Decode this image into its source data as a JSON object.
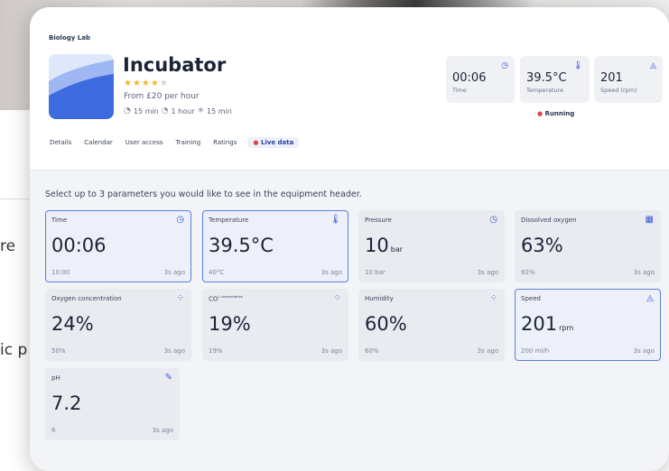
{
  "background": {
    "text_1": "re",
    "text_2": "ic p"
  },
  "breadcrumb": "Biology Lab",
  "equipment": {
    "name": "Incubator",
    "rating": 4,
    "rating_max": 5,
    "stars_filled": "★★★★",
    "stars_empty": "★",
    "price": "From £20 per hour",
    "durations": [
      "15 min",
      "1 hour",
      "15 min"
    ]
  },
  "tabs": [
    {
      "label": "Details"
    },
    {
      "label": "Calendar"
    },
    {
      "label": "User access"
    },
    {
      "label": "Training"
    },
    {
      "label": "Ratings"
    },
    {
      "label": "Live data",
      "active": true
    }
  ],
  "header_params": [
    {
      "value": "00:06",
      "label": "Time",
      "icon": "clock-icon"
    },
    {
      "value": "39.5°C",
      "label": "Temperature",
      "icon": "thermometer-icon"
    },
    {
      "value": "201",
      "label": "Speed (rpm)",
      "icon": "drop-icon"
    }
  ],
  "status": "Running",
  "instructions": "Select up to 3 parameters you would like to see in the equipment header.",
  "parameters": [
    {
      "name": "Time",
      "value": "00:06",
      "unit": "",
      "sub": "10:00",
      "ago": "3s ago",
      "icon": "clock-icon",
      "selected": true
    },
    {
      "name": "Temperature",
      "value": "39.5°C",
      "unit": "",
      "sub": "40°C",
      "ago": "3s ago",
      "icon": "thermometer-icon",
      "selected": true
    },
    {
      "name": "Pressure",
      "value": "10",
      "unit": "bar",
      "sub": "10 bar",
      "ago": "3s ago",
      "icon": "gauge-icon",
      "selected": false
    },
    {
      "name": "Dissolved oxygen",
      "value": "63%",
      "unit": "",
      "sub": "92%",
      "ago": "3s ago",
      "icon": "dots-grid-icon",
      "selected": false
    },
    {
      "name": "Oxygen concentration",
      "value": "24%",
      "unit": "",
      "sub": "50%",
      "ago": "3s ago",
      "icon": "molecule-icon",
      "selected": false
    },
    {
      "name": "CO",
      "name_sup": "2 concentration",
      "value": "19%",
      "unit": "",
      "sub": "19%",
      "ago": "3s ago",
      "icon": "molecule-icon",
      "selected": false
    },
    {
      "name": "Humidity",
      "value": "60%",
      "unit": "",
      "sub": "60%",
      "ago": "3s ago",
      "icon": "molecule-icon",
      "selected": false
    },
    {
      "name": "Speed",
      "value": "201",
      "unit": "rpm",
      "sub": "200 ml/h",
      "ago": "3s ago",
      "icon": "drop-icon",
      "selected": true
    },
    {
      "name": "pH",
      "value": "7.2",
      "unit": "",
      "sub": "6",
      "ago": "3s ago",
      "icon": "test-tube-icon",
      "selected": false
    }
  ],
  "colors": {
    "accent": "#3d5bd9",
    "status_dot": "#e04848",
    "star": "#f0b72f"
  }
}
